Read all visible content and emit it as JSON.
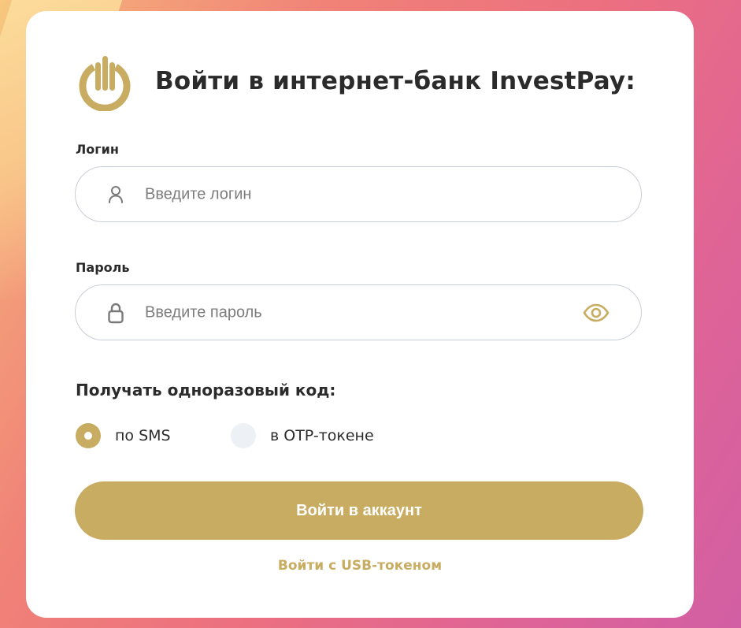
{
  "header": {
    "title": "Войти в интернет-банк InvestPay:"
  },
  "login": {
    "label": "Логин",
    "placeholder": "Введите логин",
    "value": ""
  },
  "password": {
    "label": "Пароль",
    "placeholder": "Введите пароль",
    "value": ""
  },
  "otp": {
    "heading": "Получать одноразовый код:",
    "options": [
      {
        "label": "по SMS",
        "selected": true
      },
      {
        "label": "в OTP-токене",
        "selected": false
      }
    ]
  },
  "actions": {
    "submit_label": "Войти в аккаунт",
    "usb_link_label": "Войти с USB-токеном"
  },
  "colors": {
    "accent": "#c8ac62",
    "text": "#2b2b2b",
    "field_border": "#c9ced6",
    "radio_unchecked": "#edf0f4"
  },
  "icons": {
    "logo": "power-logo-icon",
    "login": "user-icon",
    "password": "lock-icon",
    "toggle_visibility": "eye-icon"
  }
}
